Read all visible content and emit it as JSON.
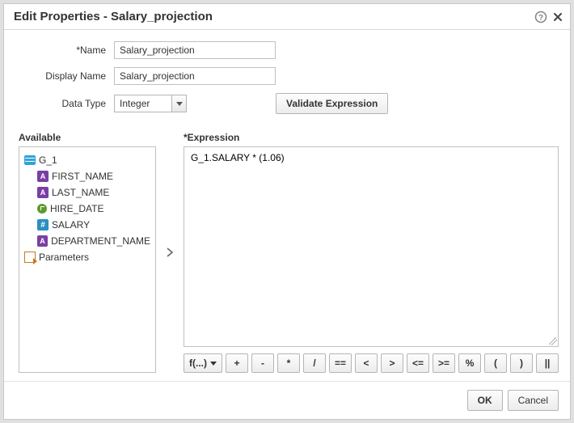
{
  "title": "Edit Properties - Salary_projection",
  "form": {
    "name_label": "*Name",
    "name_value": "Salary_projection",
    "display_name_label": "Display Name",
    "display_name_value": "Salary_projection",
    "data_type_label": "Data Type",
    "data_type_value": "Integer",
    "validate_label": "Validate Expression"
  },
  "available": {
    "label": "Available",
    "group": "G_1",
    "items": [
      {
        "label": "FIRST_NAME",
        "icon": "text"
      },
      {
        "label": "LAST_NAME",
        "icon": "text"
      },
      {
        "label": "HIRE_DATE",
        "icon": "date"
      },
      {
        "label": "SALARY",
        "icon": "number"
      },
      {
        "label": "DEPARTMENT_NAME",
        "icon": "text"
      }
    ],
    "parameters_label": "Parameters"
  },
  "expression": {
    "label": "*Expression",
    "value": "G_1.SALARY * (1.06)"
  },
  "ops": {
    "fx": "f(...)",
    "buttons": [
      "+",
      "-",
      "*",
      "/",
      "==",
      "<",
      ">",
      "<=",
      ">=",
      "%",
      "(",
      ")",
      "||"
    ]
  },
  "footer": {
    "ok": "OK",
    "cancel": "Cancel"
  }
}
